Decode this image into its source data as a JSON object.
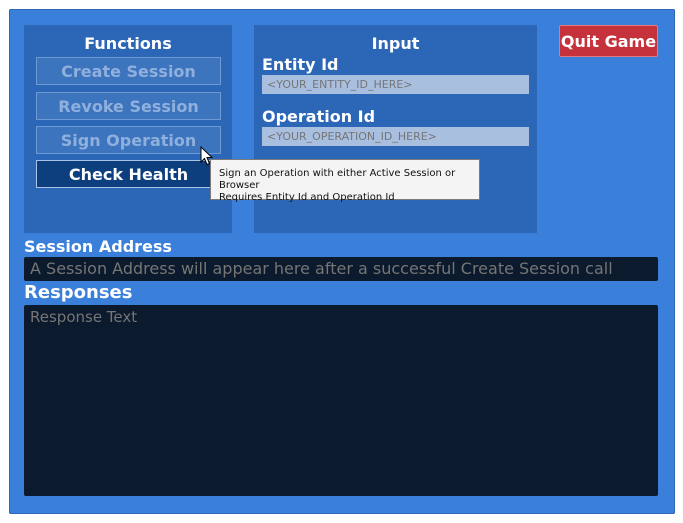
{
  "functions": {
    "title": "Functions",
    "buttons": [
      {
        "label": "Create Session"
      },
      {
        "label": "Revoke Session"
      },
      {
        "label": "Sign Operation"
      },
      {
        "label": "Check Health"
      }
    ]
  },
  "input": {
    "title": "Input",
    "entity_id": {
      "label": "Entity Id",
      "placeholder": "<YOUR_ENTITY_ID_HERE>",
      "value": ""
    },
    "operation_id": {
      "label": "Operation Id",
      "placeholder": "<YOUR_OPERATION_ID_HERE>",
      "value": ""
    }
  },
  "quit_label": "Quit Game",
  "session_address": {
    "label": "Session Address",
    "placeholder": "A Session Address will appear here after a successful Create Session call",
    "value": ""
  },
  "responses": {
    "label": "Responses",
    "placeholder": "Response Text",
    "value": ""
  },
  "tooltip": {
    "line1": "Sign an Operation with either Active Session or Browser",
    "line2": "Requires Entity Id and Operation Id"
  },
  "colors": {
    "frame": "#3a7fd9",
    "panel": "#2c66b6",
    "quit": "#c6323c",
    "dark_field": "#0b1a2d"
  }
}
